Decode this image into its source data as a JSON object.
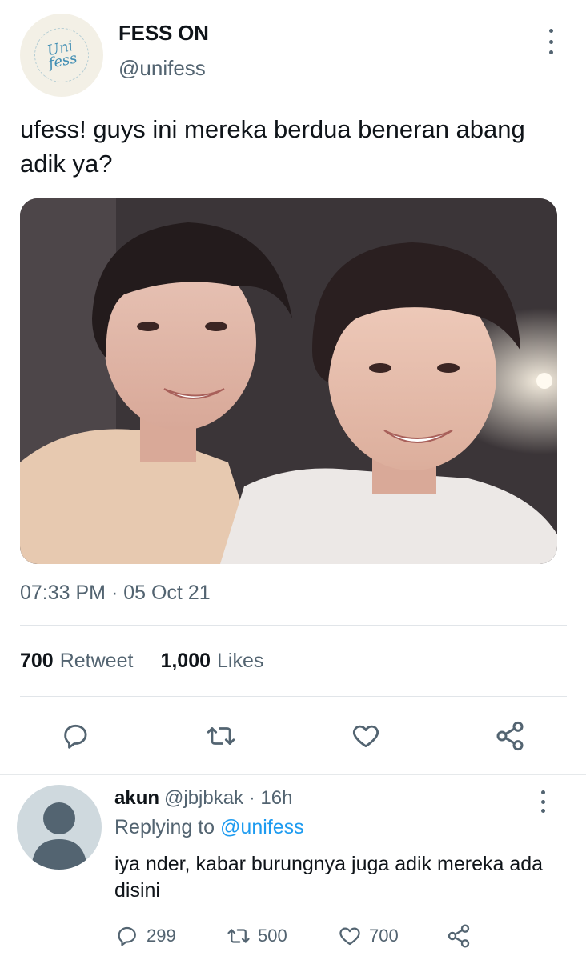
{
  "tweet": {
    "display_name": "FESS ON",
    "handle": "@unifess",
    "avatar_logo_line1": "Uni",
    "avatar_logo_line2": "fess",
    "text": "ufess! guys ini mereka berdua beneran abang adik ya?",
    "timestamp": "07:33 PM · 05 Oct 21",
    "retweet_count": "700",
    "retweet_label": "Retweet",
    "likes_count": "1,000",
    "likes_label": "Likes"
  },
  "reply": {
    "name": "akun",
    "handle_time": "@jbjbkak · 16h",
    "replying_prefix": "Replying to",
    "replying_mention": "@unifess",
    "text": "iya nder, kabar burungnya juga adik mereka ada disini",
    "reply_count": "299",
    "retweet_count": "500",
    "like_count": "700"
  },
  "colors": {
    "accent": "#1d9bf0",
    "muted": "#536471",
    "text": "#0f1419"
  },
  "icons": [
    "more-vertical-icon",
    "reply-icon",
    "retweet-icon",
    "like-icon",
    "share-icon",
    "default-avatar-icon"
  ]
}
